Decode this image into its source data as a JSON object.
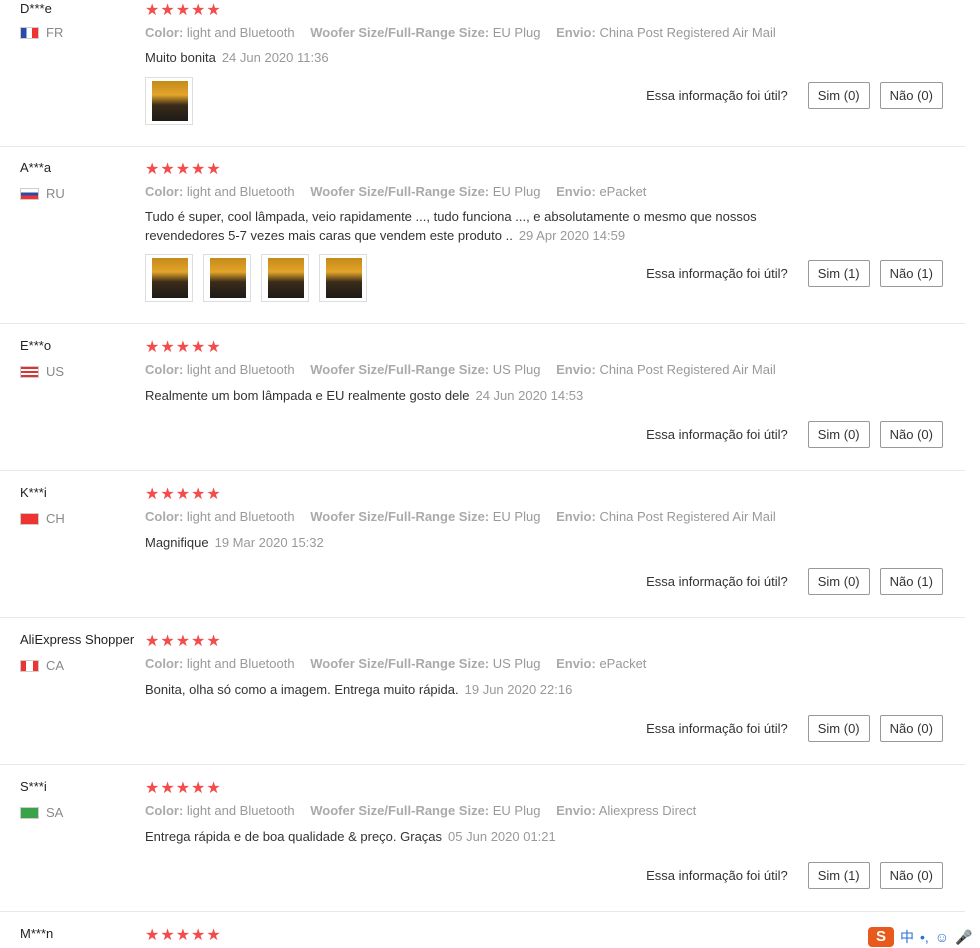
{
  "labels": {
    "color": "Color:",
    "woofer": "Woofer Size/Full-Range Size:",
    "envio": "Envio:",
    "helpful_q": "Essa informação foi útil?"
  },
  "stars": "★★★★★",
  "reviews": [
    {
      "user": "D***e",
      "country": "FR",
      "color": "light and Bluetooth",
      "woofer": "EU Plug",
      "envio": "China Post Registered Air Mail",
      "text": "Muito bonita",
      "date": "24 Jun 2020 11:36",
      "photos": 1,
      "sim": "Sim (0)",
      "nao": "Não (0)"
    },
    {
      "user": "A***a",
      "country": "RU",
      "color": "light and Bluetooth",
      "woofer": "EU Plug",
      "envio": "ePacket",
      "text": "Tudo é super, cool lâmpada, veio rapidamente ..., tudo funciona ..., e absolutamente o mesmo que nossos revendedores 5-7 vezes mais caras que vendem este produto ..",
      "date": "29 Apr 2020 14:59",
      "photos": 4,
      "sim": "Sim (1)",
      "nao": "Não (1)"
    },
    {
      "user": "E***o",
      "country": "US",
      "color": "light and Bluetooth",
      "woofer": "US Plug",
      "envio": "China Post Registered Air Mail",
      "text": "Realmente um bom lâmpada e EU realmente gosto dele",
      "date": "24 Jun 2020 14:53",
      "photos": 0,
      "sim": "Sim (0)",
      "nao": "Não (0)"
    },
    {
      "user": "K***i",
      "country": "CH",
      "color": "light and Bluetooth",
      "woofer": "EU Plug",
      "envio": "China Post Registered Air Mail",
      "text": "Magnifique",
      "date": "19 Mar 2020 15:32",
      "photos": 0,
      "sim": "Sim (0)",
      "nao": "Não (1)"
    },
    {
      "user": "AliExpress Shopper",
      "country": "CA",
      "color": "light and Bluetooth",
      "woofer": "US Plug",
      "envio": "ePacket",
      "text": "Bonita, olha só como a imagem. Entrega muito rápida.",
      "date": "19 Jun 2020 22:16",
      "photos": 0,
      "sim": "Sim (0)",
      "nao": "Não (0)"
    },
    {
      "user": "S***i",
      "country": "SA",
      "color": "light and Bluetooth",
      "woofer": "EU Plug",
      "envio": "Aliexpress Direct",
      "text": "Entrega rápida e de boa qualidade & preço. Graças",
      "date": "05 Jun 2020 01:21",
      "photos": 0,
      "sim": "Sim (1)",
      "nao": "Não (0)"
    },
    {
      "user": "M***n"
    }
  ],
  "ime": {
    "logo": "S",
    "lang": "中",
    "punct": "•,",
    "emoji": "☺",
    "mic": "🎤"
  }
}
